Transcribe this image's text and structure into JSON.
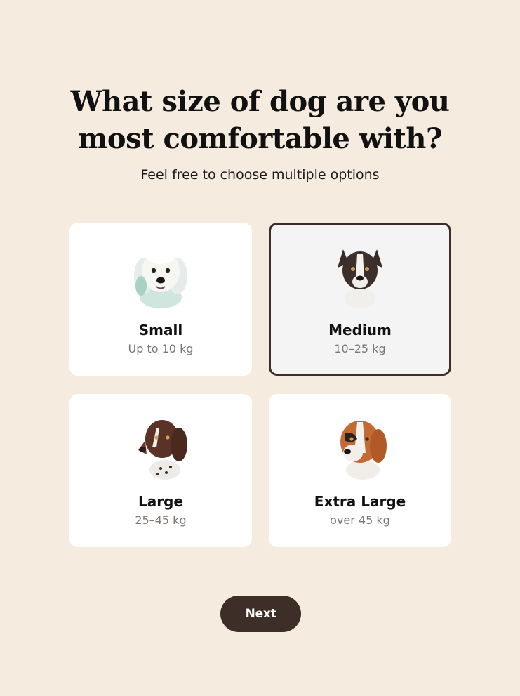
{
  "question": {
    "line1": "What size of dog are you",
    "line2": "most comfortable with?",
    "subtitle": "Feel free to choose multiple options"
  },
  "options": [
    {
      "name": "Small",
      "range": "Up to 10 kg",
      "selected": false,
      "icon": "maltese-dog-icon"
    },
    {
      "name": "Medium",
      "range": "10–25 kg",
      "selected": true,
      "icon": "border-collie-dog-icon"
    },
    {
      "name": "Large",
      "range": "25–45 kg",
      "selected": false,
      "icon": "pointer-dog-icon"
    },
    {
      "name": "Extra Large",
      "range": "over 45 kg",
      "selected": false,
      "icon": "saint-bernard-dog-icon"
    }
  ],
  "next_label": "Next",
  "colors": {
    "background": "#f5ebdf",
    "card": "#ffffff",
    "selected_card": "#f4f4f4",
    "accent": "#3d2f28",
    "muted_text": "#7d7671"
  }
}
